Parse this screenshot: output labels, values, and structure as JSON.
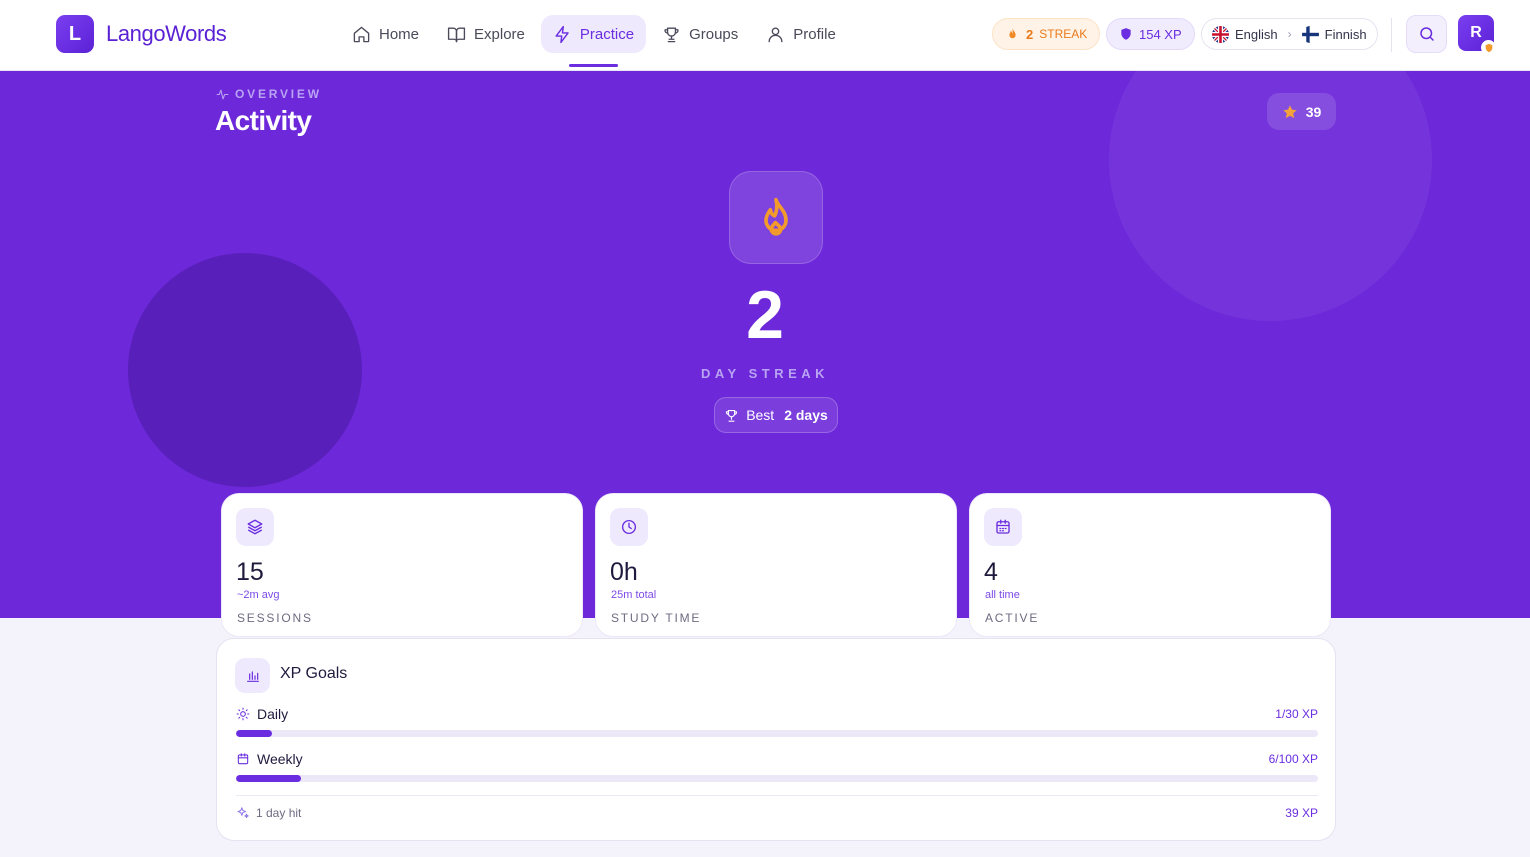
{
  "brand": {
    "logo_letter": "L",
    "name": "LangoWords"
  },
  "nav": {
    "items": [
      {
        "label": "Home",
        "icon": "home-icon",
        "active": false
      },
      {
        "label": "Explore",
        "icon": "book-icon",
        "active": false
      },
      {
        "label": "Practice",
        "icon": "lightning-icon",
        "active": true
      },
      {
        "label": "Groups",
        "icon": "trophy-icon",
        "active": false
      },
      {
        "label": "Profile",
        "icon": "user-icon",
        "active": false
      }
    ]
  },
  "header": {
    "streak": {
      "count": "2",
      "label": "STREAK"
    },
    "xp": {
      "value": "154 XP"
    },
    "languages": {
      "from": "English",
      "to": "Finnish"
    },
    "avatar_letter": "R"
  },
  "hero": {
    "overline": "OVERVIEW",
    "title": "Activity",
    "stars": "39",
    "streak_number": "2",
    "streak_label": "DAY STREAK",
    "best_prefix": "Best",
    "best_value": "2 days"
  },
  "stats": [
    {
      "value": "15",
      "sub": "~2m avg",
      "label": "SESSIONS",
      "icon": "layers-icon"
    },
    {
      "value": "0h",
      "sub": "25m total",
      "label": "STUDY TIME",
      "icon": "clock-icon"
    },
    {
      "value": "4",
      "sub": "all time",
      "label": "ACTIVE",
      "icon": "calendar-icon"
    }
  ],
  "goals": {
    "title": "XP Goals",
    "daily": {
      "label": "Daily",
      "value_text": "1/30 XP",
      "fraction": 0.033
    },
    "weekly": {
      "label": "Weekly",
      "value_text": "6/100 XP",
      "fraction": 0.06
    },
    "footer_left": "1 day hit",
    "footer_right": "39 XP"
  },
  "colors": {
    "accent": "#6d28d9",
    "accent_dark": "#5b21d4",
    "streak_orange": "#ea7a1a",
    "progress": "#6a2ee0"
  }
}
